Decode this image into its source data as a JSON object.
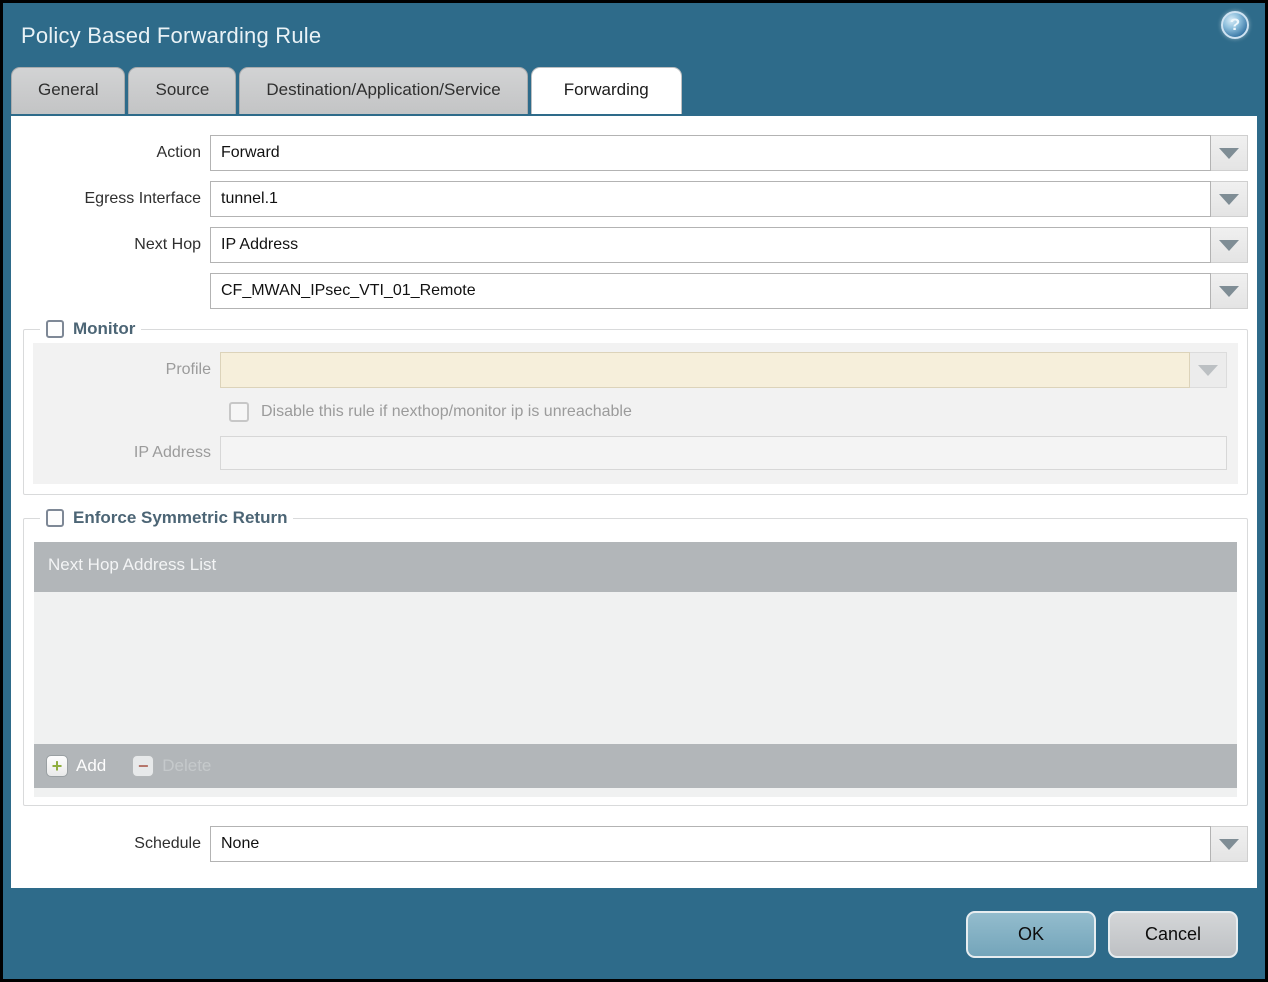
{
  "dialog": {
    "title": "Policy Based Forwarding Rule",
    "help_glyph": "?"
  },
  "tabs": [
    {
      "label": "General",
      "active": false
    },
    {
      "label": "Source",
      "active": false
    },
    {
      "label": "Destination/Application/Service",
      "active": false
    },
    {
      "label": "Forwarding",
      "active": true
    }
  ],
  "form": {
    "action": {
      "label": "Action",
      "value": "Forward"
    },
    "egress_interface": {
      "label": "Egress Interface",
      "value": "tunnel.1"
    },
    "next_hop": {
      "label": "Next Hop",
      "value": "IP Address"
    },
    "next_hop_address": {
      "value": "CF_MWAN_IPsec_VTI_01_Remote"
    },
    "schedule": {
      "label": "Schedule",
      "value": "None"
    }
  },
  "monitor": {
    "title": "Monitor",
    "checked": false,
    "profile": {
      "label": "Profile",
      "value": ""
    },
    "disable_rule": {
      "label": "Disable this rule if nexthop/monitor ip is unreachable",
      "checked": false
    },
    "ip_address": {
      "label": "IP Address",
      "value": ""
    }
  },
  "symmetric_return": {
    "title": "Enforce Symmetric Return",
    "checked": false,
    "table_header": "Next Hop Address List",
    "rows": [],
    "add_label": "Add",
    "delete_label": "Delete",
    "add_glyph": "+",
    "delete_glyph": "−"
  },
  "footer": {
    "ok_label": "OK",
    "cancel_label": "Cancel"
  },
  "colors": {
    "frame_teal": "#2e6b8a",
    "active_tab": "#ffffff",
    "inactive_tab": "#c9cacb",
    "table_chrome": "#b2b6b9",
    "disabled_input_beige": "#f6efdb",
    "ok_button": "#7fadc2",
    "cancel_button": "#c7cacd",
    "add_plus_green": "#8fae3e",
    "delete_minus_red": "#b5756a"
  }
}
